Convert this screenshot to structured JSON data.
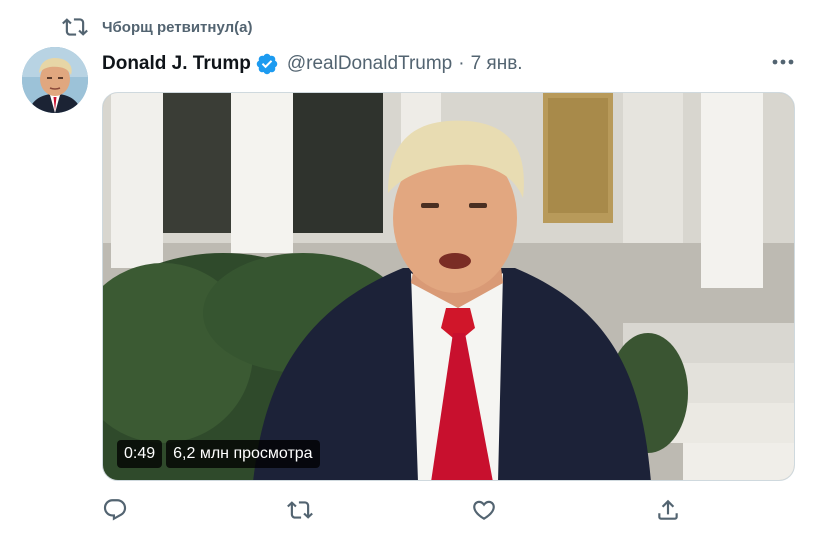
{
  "social_context": {
    "text": "Чборщ ретвитнул(а)",
    "icon": "retweet-icon"
  },
  "tweet": {
    "display_name": "Donald J. Trump",
    "verified": true,
    "handle": "@realDonaldTrump",
    "separator": "·",
    "time": "7 янв.",
    "media": {
      "type": "video",
      "duration": "0:49",
      "views": "6,2 млн просмотра"
    }
  },
  "actions": [
    {
      "name": "reply",
      "icon": "reply-icon"
    },
    {
      "name": "retweet",
      "icon": "retweet-icon"
    },
    {
      "name": "like",
      "icon": "heart-icon"
    },
    {
      "name": "share",
      "icon": "share-icon"
    }
  ],
  "colors": {
    "secondary_text": "#536471",
    "verified_blue": "#1d9bf0",
    "icon_gray": "#536471"
  }
}
